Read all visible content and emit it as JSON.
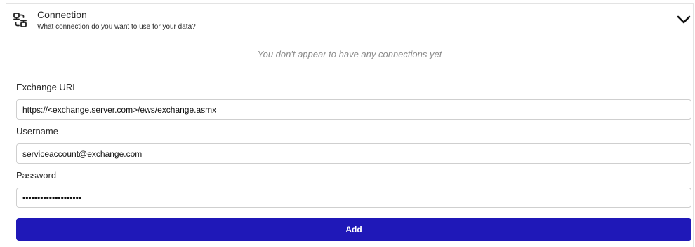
{
  "header": {
    "title": "Connection",
    "subtitle": "What connection do you want to use for your data?",
    "icon": "connection-icon",
    "toggle_icon": "chevron-down-icon"
  },
  "empty_message": "You don't appear to have any connections yet",
  "form": {
    "exchange_url": {
      "label": "Exchange URL",
      "value": "https://<exchange.server.com>/ews/exchange.asmx"
    },
    "username": {
      "label": "Username",
      "value": "serviceaccount@exchange.com"
    },
    "password": {
      "label": "Password",
      "value": "••••••••••••••••••••"
    },
    "submit_label": "Add"
  },
  "colors": {
    "accent": "#1f18b8",
    "border": "#e3e3e3",
    "muted_text": "#8b8b8b"
  }
}
